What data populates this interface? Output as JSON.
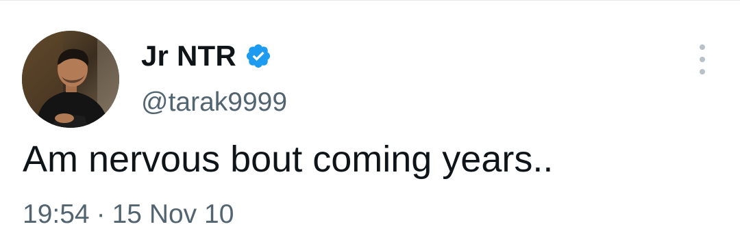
{
  "tweet": {
    "author": {
      "display_name": "Jr NTR",
      "handle": "@tarak9999",
      "verified": true,
      "verified_icon": "verified-badge-icon",
      "avatar_icon": "profile-photo"
    },
    "text": "Am nervous bout coming years..",
    "time": "19:54",
    "separator": "·",
    "date": "15 Nov 10",
    "more_icon": "more-options-icon"
  },
  "colors": {
    "text_primary": "#0f1419",
    "text_secondary": "#536471",
    "verified_blue": "#1d9bf0",
    "more_dots": "#b9c1c8"
  }
}
